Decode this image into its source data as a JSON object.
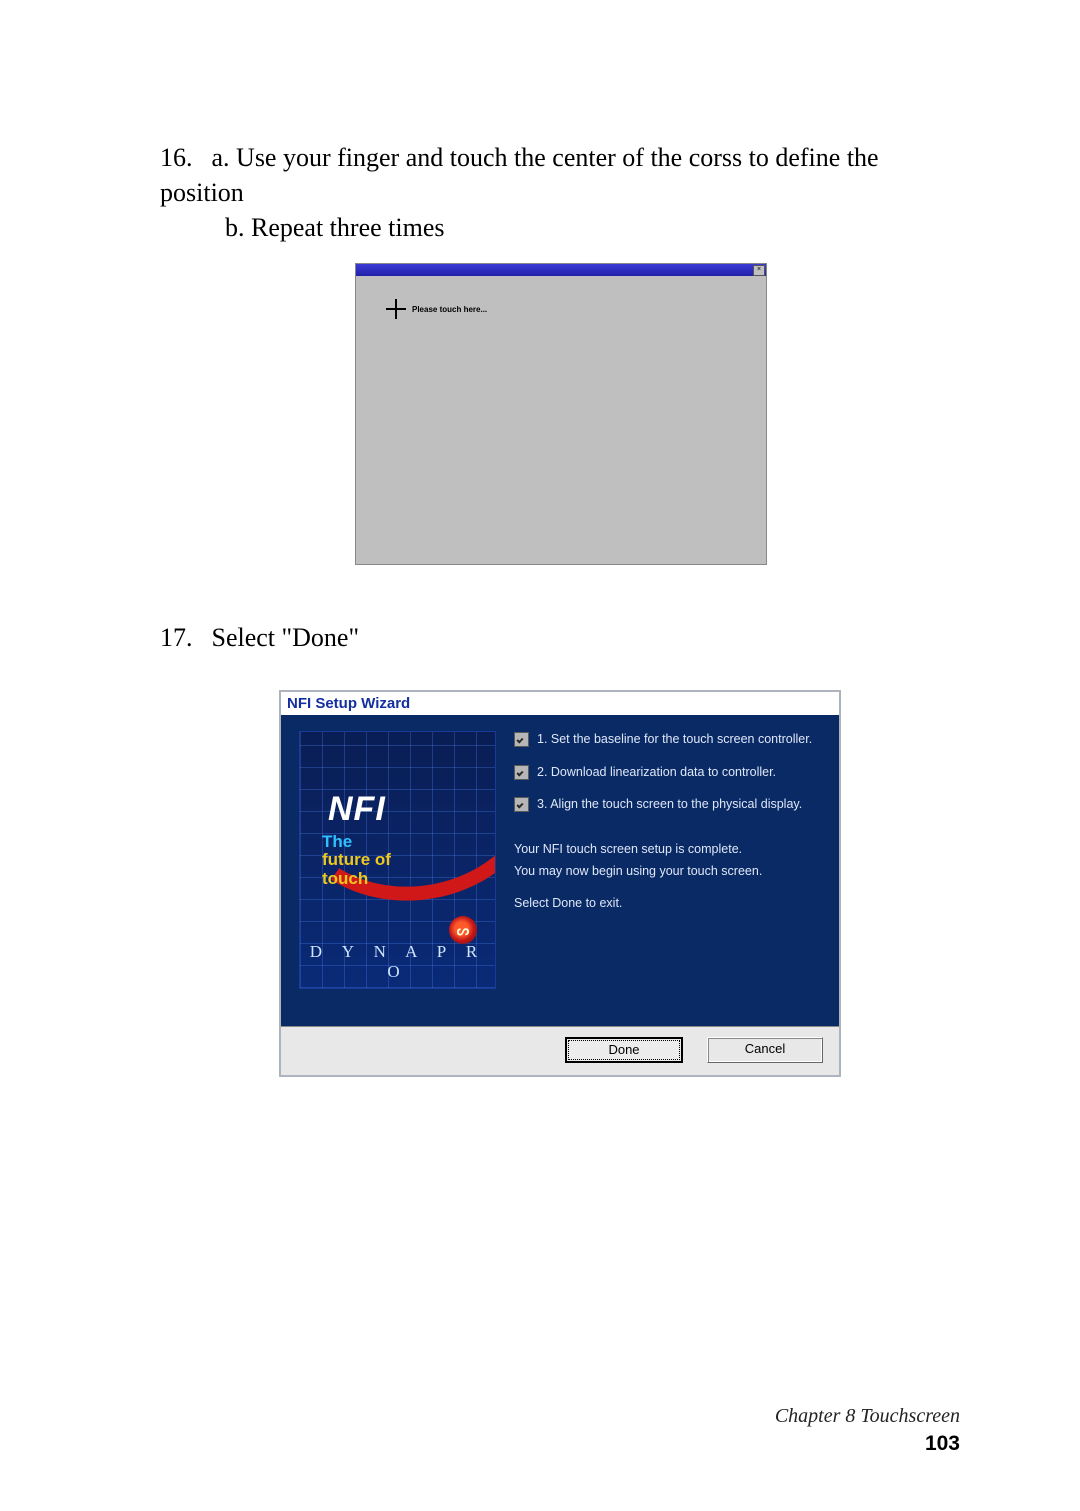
{
  "step16": {
    "number": "16.",
    "line_a": "a. Use your finger and touch the center of the corss to define the position",
    "line_b": "b. Repeat three times"
  },
  "calibration": {
    "touch_here": "Please touch here...",
    "close_glyph": "×"
  },
  "step17": {
    "number": "17.",
    "text": "Select \"Done\""
  },
  "wizard": {
    "title": "NFI Setup Wizard",
    "logo_nfi": "NFI",
    "logo_tag1": "The",
    "logo_tag2": "future of",
    "logo_tag3": "touch",
    "logo_brand": "D Y N A P R O",
    "spiral_glyph": "ᔕ",
    "steps": [
      "1.  Set the baseline for the touch screen controller.",
      "2.  Download linearization data to controller.",
      "3.  Align the touch screen to the physical display."
    ],
    "complete1": "Your NFI touch screen setup is complete.",
    "complete2": "You may now begin using your touch screen.",
    "complete3": "Select Done to exit.",
    "done_btn": "Done",
    "cancel_btn": "Cancel"
  },
  "footer": {
    "chapter": "Chapter 8   Touchscreen",
    "page_number": "103"
  }
}
